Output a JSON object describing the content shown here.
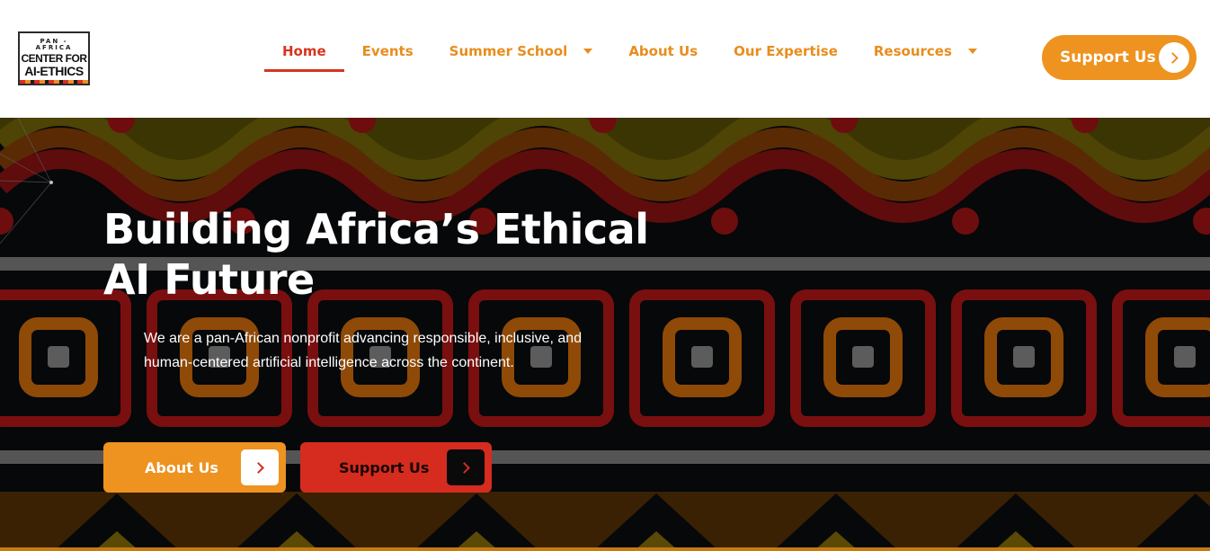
{
  "logo": {
    "line1": "PAN - AFRICA",
    "line2": "CENTER FOR",
    "line3": "AI-ETHICS"
  },
  "nav": {
    "items": [
      {
        "label": "Home"
      },
      {
        "label": "Events"
      },
      {
        "label": "Summer School"
      },
      {
        "label": "About Us"
      },
      {
        "label": "Our Expertise"
      },
      {
        "label": "Resources"
      }
    ]
  },
  "header": {
    "support_label": "Support Us"
  },
  "hero": {
    "title": "Building Africa’s Ethical AI Future",
    "description": "We are a pan-African nonprofit advancing responsible, inclusive, and human-centered artificial intelligence across the continent.",
    "about_label": "About Us",
    "support_label": "Support Us"
  },
  "colors": {
    "accent_orange": "#ee9220",
    "accent_red": "#d52c1f",
    "background_dark": "#06080a"
  },
  "icons": {
    "arrow": "chevron-right-icon",
    "dropdown": "caret-down-icon"
  }
}
